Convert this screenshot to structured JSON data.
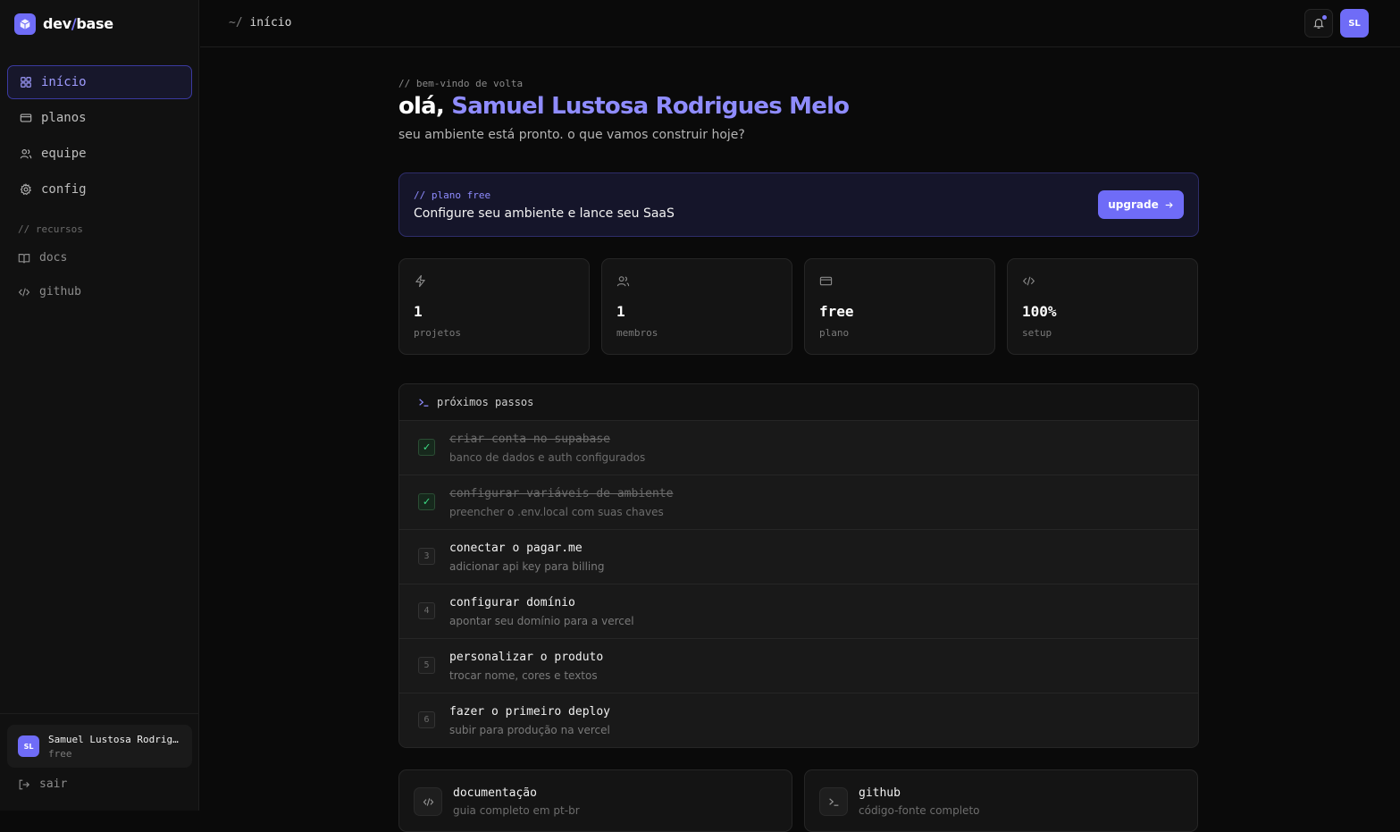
{
  "brand": {
    "name_a": "dev",
    "slash": "/",
    "name_b": "base",
    "accent": "#6f6cf7",
    "logo_icon": "cube-icon"
  },
  "sidebar": {
    "items": [
      {
        "label": "início",
        "icon": "grid-icon",
        "active": true
      },
      {
        "label": "planos",
        "icon": "card-icon"
      },
      {
        "label": "equipe",
        "icon": "users-icon"
      },
      {
        "label": "config",
        "icon": "gear-icon"
      }
    ],
    "resources_title": "// recursos",
    "resources": [
      {
        "label": "docs",
        "icon": "book-icon"
      },
      {
        "label": "github",
        "icon": "code-icon"
      }
    ],
    "user": {
      "initials": "SL",
      "name": "Samuel Lustosa Rodrigues Melo",
      "plan": "free"
    },
    "logout_label": "sair"
  },
  "topbar": {
    "tilde": "~/",
    "crumb": "início",
    "user_initials": "SL",
    "bell_icon": "bell-icon"
  },
  "welcome": {
    "tag": "// bem-vindo de volta",
    "greeting": "olá,",
    "name": "Samuel Lustosa Rodrigues Melo",
    "subtitle": "seu ambiente está pronto. o que vamos construir hoje?"
  },
  "plan_banner": {
    "tag": "// plano free",
    "text": "Configure seu ambiente e lance seu SaaS",
    "button": "upgrade"
  },
  "stats": [
    {
      "icon": "bolt-icon",
      "value": "1",
      "label": "projetos"
    },
    {
      "icon": "users-icon",
      "value": "1",
      "label": "membros"
    },
    {
      "icon": "card-icon",
      "value": "free",
      "label": "plano"
    },
    {
      "icon": "code-icon",
      "value": "100%",
      "label": "setup"
    }
  ],
  "steps": {
    "title": "próximos passos",
    "items": [
      {
        "marker": "✓",
        "done": true,
        "title": "criar conta no supabase",
        "sub": "banco de dados e auth configurados"
      },
      {
        "marker": "✓",
        "done": true,
        "title": "configurar variáveis de ambiente",
        "sub": "preencher o .env.local com suas chaves"
      },
      {
        "marker": "3",
        "done": false,
        "title": "conectar o pagar.me",
        "sub": "adicionar api key para billing"
      },
      {
        "marker": "4",
        "done": false,
        "title": "configurar domínio",
        "sub": "apontar seu domínio para a vercel"
      },
      {
        "marker": "5",
        "done": false,
        "title": "personalizar o produto",
        "sub": "trocar nome, cores e textos"
      },
      {
        "marker": "6",
        "done": false,
        "title": "fazer o primeiro deploy",
        "sub": "subir para produção na vercel"
      }
    ]
  },
  "links": [
    {
      "icon": "code-icon",
      "title": "documentação",
      "sub": "guia completo em pt-br"
    },
    {
      "icon": "terminal-icon",
      "title": "github",
      "sub": "código-fonte completo"
    }
  ]
}
